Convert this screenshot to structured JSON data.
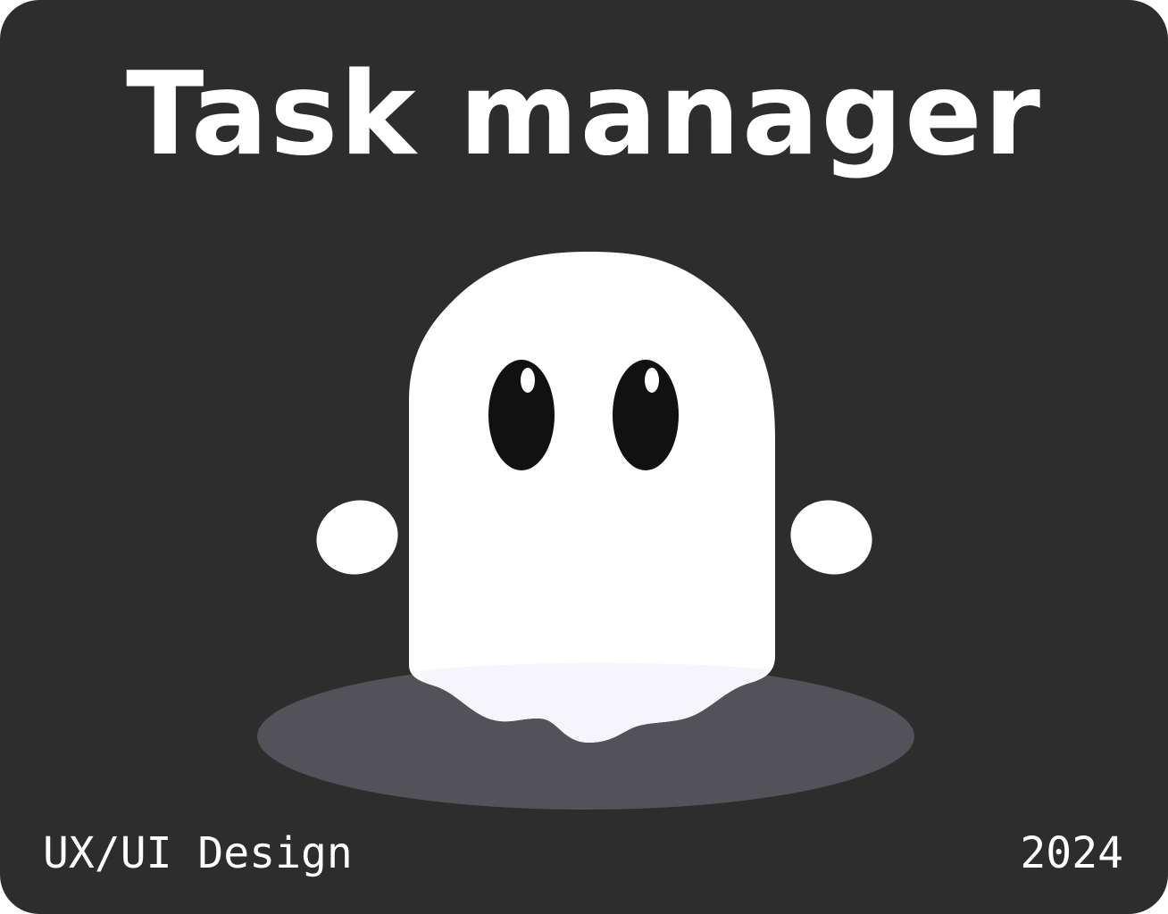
{
  "title": "Task manager",
  "footer": {
    "category": "UX/UI Design",
    "year": "2024"
  },
  "illustration": {
    "icon": "ghost-icon"
  },
  "colors": {
    "background": "#2d2d2d",
    "text": "#ffffff",
    "ghost": "#ffffff",
    "ghost_tint": "#f6f5fc",
    "eyes": "#111111",
    "shadow": "#535258"
  }
}
